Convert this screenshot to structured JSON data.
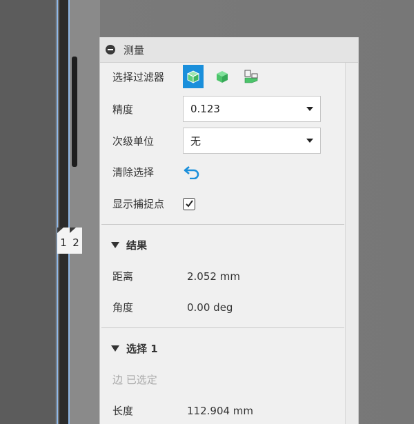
{
  "panel": {
    "title": "测量"
  },
  "filter": {
    "label": "选择过滤器",
    "options": [
      "body-filter",
      "face-filter",
      "edge-filter"
    ],
    "active": 0
  },
  "precision": {
    "label": "精度",
    "value": "0.123"
  },
  "secondary_unit": {
    "label": "次级单位",
    "value": "无"
  },
  "clear": {
    "label": "清除选择"
  },
  "show_snap": {
    "label": "显示捕捉点",
    "checked": true
  },
  "results": {
    "title": "结果",
    "distance_label": "距离",
    "distance_value": "2.052 mm",
    "angle_label": "角度",
    "angle_value": "0.00 deg"
  },
  "selection1": {
    "title": "选择 1",
    "status": "边 已选定",
    "length_label": "长度",
    "length_value": "112.904 mm"
  },
  "viewport": {
    "marker1": "1",
    "marker2": "2"
  },
  "colors": {
    "accent": "#1a8fdb",
    "cube_green": "#4cc46a"
  }
}
